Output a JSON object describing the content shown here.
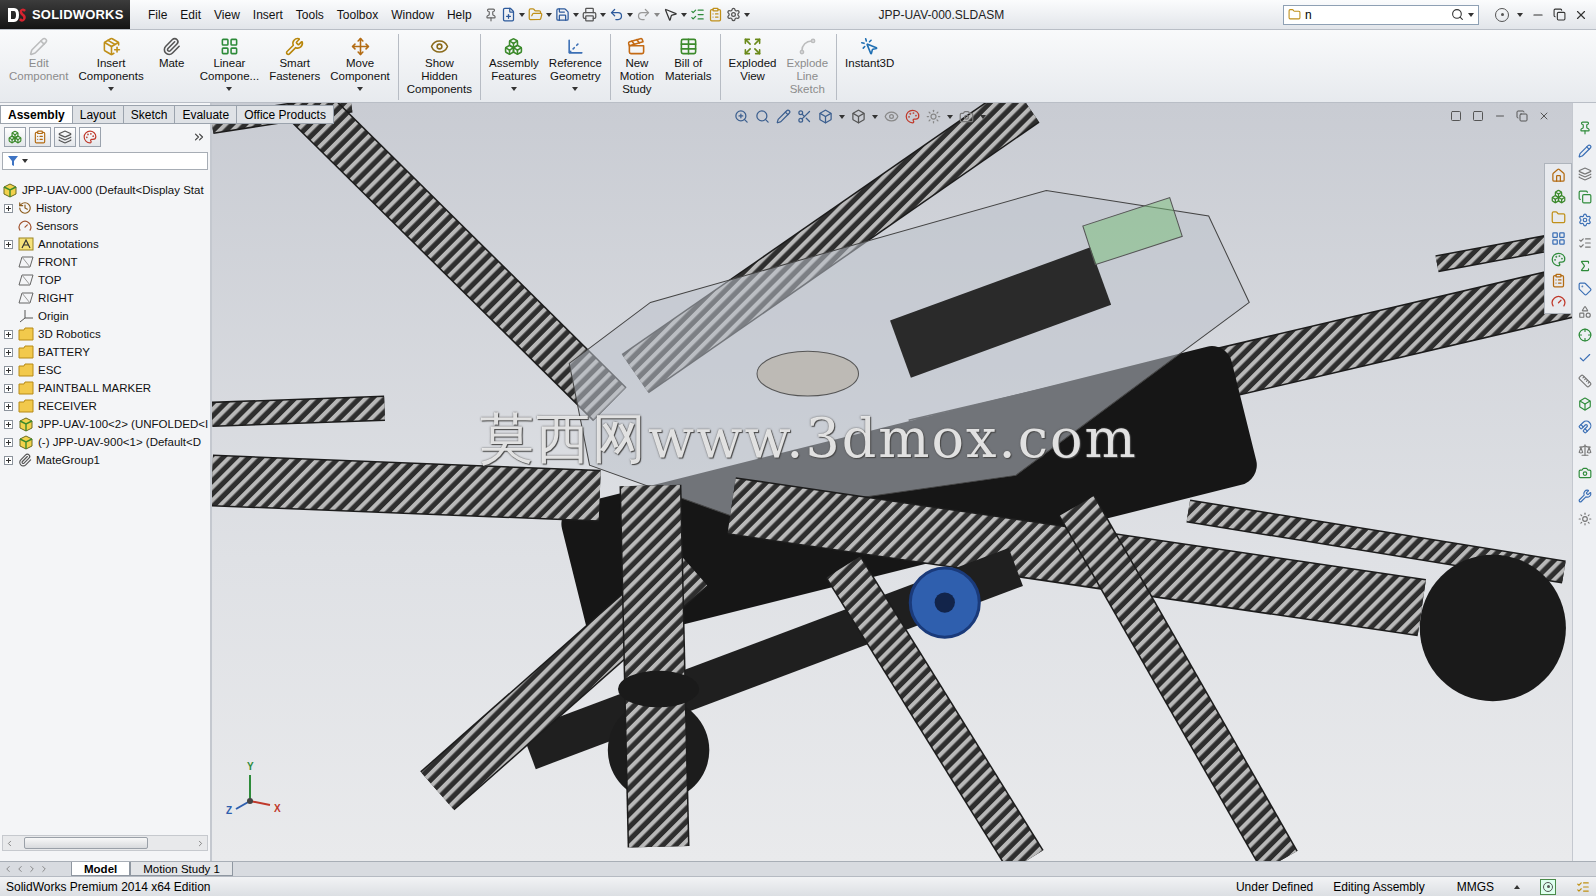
{
  "window": {
    "app": "SOLIDWORKS",
    "title": "JPP-UAV-000.SLDASM"
  },
  "menu": [
    "File",
    "Edit",
    "View",
    "Insert",
    "Tools",
    "Toolbox",
    "Window",
    "Help"
  ],
  "search": {
    "value": "n"
  },
  "ribbon": [
    {
      "lines": [
        "Edit",
        "Component"
      ],
      "disabled": true,
      "dropdown": false,
      "separator_after": false
    },
    {
      "lines": [
        "Insert",
        "Components"
      ],
      "disabled": false,
      "dropdown": true,
      "separator_after": false
    },
    {
      "lines": [
        "Mate"
      ],
      "disabled": false,
      "dropdown": false,
      "separator_after": false
    },
    {
      "lines": [
        "Linear",
        "Compone..."
      ],
      "disabled": false,
      "dropdown": true,
      "separator_after": false
    },
    {
      "lines": [
        "Smart",
        "Fasteners"
      ],
      "disabled": false,
      "dropdown": false,
      "separator_after": false
    },
    {
      "lines": [
        "Move",
        "Component"
      ],
      "disabled": false,
      "dropdown": true,
      "separator_after": true
    },
    {
      "lines": [
        "Show",
        "Hidden",
        "Components"
      ],
      "disabled": false,
      "dropdown": false,
      "separator_after": true
    },
    {
      "lines": [
        "Assembly",
        "Features"
      ],
      "disabled": false,
      "dropdown": true,
      "separator_after": false
    },
    {
      "lines": [
        "Reference",
        "Geometry"
      ],
      "disabled": false,
      "dropdown": true,
      "separator_after": true
    },
    {
      "lines": [
        "New",
        "Motion",
        "Study"
      ],
      "disabled": false,
      "dropdown": false,
      "separator_after": false
    },
    {
      "lines": [
        "Bill of",
        "Materials"
      ],
      "disabled": false,
      "dropdown": false,
      "separator_after": true
    },
    {
      "lines": [
        "Exploded",
        "View"
      ],
      "disabled": false,
      "dropdown": false,
      "separator_after": false
    },
    {
      "lines": [
        "Explode",
        "Line",
        "Sketch"
      ],
      "disabled": true,
      "dropdown": false,
      "separator_after": true
    },
    {
      "lines": [
        "Instant3D"
      ],
      "disabled": false,
      "dropdown": false,
      "separator_after": false
    }
  ],
  "tabs": [
    {
      "label": "Assembly",
      "selected": true
    },
    {
      "label": "Layout",
      "selected": false
    },
    {
      "label": "Sketch",
      "selected": false
    },
    {
      "label": "Evaluate",
      "selected": false
    },
    {
      "label": "Office Products",
      "selected": false
    }
  ],
  "tree": [
    {
      "label": "JPP-UAV-000 (Default<Display Stat",
      "kind": "assembly",
      "depth": 0,
      "expandable": false
    },
    {
      "label": "History",
      "kind": "history",
      "depth": 1,
      "expandable": true
    },
    {
      "label": "Sensors",
      "kind": "sensors",
      "depth": 1,
      "expandable": false
    },
    {
      "label": "Annotations",
      "kind": "annotations",
      "depth": 1,
      "expandable": true
    },
    {
      "label": "FRONT",
      "kind": "plane",
      "depth": 1,
      "expandable": false
    },
    {
      "label": "TOP",
      "kind": "plane",
      "depth": 1,
      "expandable": false
    },
    {
      "label": "RIGHT",
      "kind": "plane",
      "depth": 1,
      "expandable": false
    },
    {
      "label": "Origin",
      "kind": "origin",
      "depth": 1,
      "expandable": false
    },
    {
      "label": "3D Robotics",
      "kind": "folder",
      "depth": 1,
      "expandable": true
    },
    {
      "label": "BATTERY",
      "kind": "folder",
      "depth": 1,
      "expandable": true
    },
    {
      "label": "ESC",
      "kind": "folder",
      "depth": 1,
      "expandable": true
    },
    {
      "label": "PAINTBALL MARKER",
      "kind": "folder",
      "depth": 1,
      "expandable": true
    },
    {
      "label": "RECEIVER",
      "kind": "folder",
      "depth": 1,
      "expandable": true
    },
    {
      "label": "JPP-UAV-100<2> (UNFOLDED<I",
      "kind": "subassembly",
      "depth": 1,
      "expandable": true
    },
    {
      "label": "(-) JPP-UAV-900<1> (Default<D",
      "kind": "subassembly",
      "depth": 1,
      "expandable": true
    },
    {
      "label": "MateGroup1",
      "kind": "mategroup",
      "depth": 1,
      "expandable": true
    }
  ],
  "viewport": {
    "watermark": "莫西网www.3dmox.com",
    "triad": {
      "y": "Y",
      "z": "Z",
      "x": "X"
    }
  },
  "bottom_tabs": [
    {
      "label": "Model",
      "selected": true
    },
    {
      "label": "Motion Study 1",
      "selected": false
    }
  ],
  "status_bar": {
    "edition": "SolidWorks Premium 2014 x64 Edition",
    "state": "Under Defined",
    "mode": "Editing Assembly",
    "units": "MMGS"
  }
}
